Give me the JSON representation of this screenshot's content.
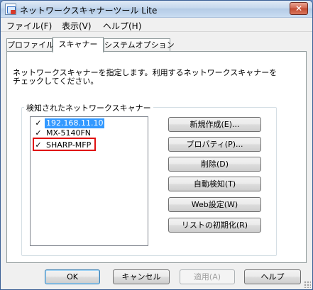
{
  "window": {
    "title": "ネットワークスキャナーツール Lite",
    "close_glyph": "✕"
  },
  "menu": {
    "items": [
      "ファイル(F)",
      "表示(V)",
      "ヘルプ(H)"
    ]
  },
  "tabs": [
    {
      "label": "プロファイル",
      "active": false
    },
    {
      "label": "スキャナー",
      "active": true
    },
    {
      "label": "システムオプション",
      "active": false
    }
  ],
  "scanner_tab": {
    "description": "ネットワークスキャナーを指定します。利用するネットワークスキャナーをチェックしてください。",
    "group_title": "検知されたネットワークスキャナー",
    "scanners": [
      {
        "name": "192.168.11.10",
        "checked": true,
        "selected": true
      },
      {
        "name": "MX-5140FN",
        "checked": true,
        "selected": false
      },
      {
        "name": "SHARP-MFP",
        "checked": true,
        "selected": false,
        "highlighted": true
      }
    ],
    "highlight_color": "#e01010",
    "checkmark": "✓",
    "buttons": {
      "new": "新規作成(E)...",
      "properties": "プロパティ(P)...",
      "delete": "削除(D)",
      "auto_detect": "自動検知(T)",
      "web_settings": "Web設定(W)",
      "reset_list": "リストの初期化(R)"
    }
  },
  "footer": {
    "ok": "OK",
    "cancel": "キャンセル",
    "apply": "適用(A)",
    "help": "ヘルプ",
    "apply_enabled": false
  }
}
